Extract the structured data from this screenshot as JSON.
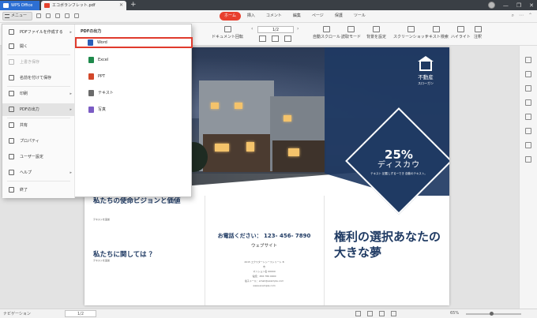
{
  "titlebar": {
    "tabs": [
      {
        "label": "WPS Office"
      },
      {
        "label": "エコボランフレット.pdf"
      }
    ],
    "add_tab": "+",
    "controls": {
      "minimize": "—",
      "restore": "❐",
      "close": "✕"
    }
  },
  "menubar": {
    "menu_label": "メニュー",
    "ribbon_tabs": [
      "ホーム",
      "挿入",
      "コメント",
      "編集",
      "ページ",
      "保護",
      "ツール"
    ],
    "active_tab": "ホーム"
  },
  "toolbar": {
    "doc_rotate": "ドキュメント回転",
    "page_input": "1/2",
    "items": [
      "自動スクロール",
      "読取モード",
      "背景を設定",
      "スクリーンショット",
      "テキスト検索",
      "ハイライト",
      "注釈"
    ]
  },
  "dropdown": {
    "left_items": [
      {
        "label": "PDFファイルを作成する",
        "disabled": false,
        "has_arrow": true
      },
      {
        "label": "開く",
        "disabled": false,
        "has_arrow": false
      },
      {
        "label": "上書き保存",
        "disabled": true,
        "has_arrow": false
      },
      {
        "label": "名前を付けて保存",
        "disabled": false,
        "has_arrow": false
      },
      {
        "label": "印刷",
        "disabled": false,
        "has_arrow": true
      },
      {
        "label": "PDFの出力",
        "disabled": false,
        "has_arrow": true,
        "active": true
      },
      {
        "label": "共有",
        "disabled": false,
        "has_arrow": false
      },
      {
        "label": "プロパティ",
        "disabled": false,
        "has_arrow": false
      },
      {
        "label": "ユーザー設定",
        "disabled": false,
        "has_arrow": false
      },
      {
        "label": "ヘルプ",
        "disabled": false,
        "has_arrow": true
      },
      {
        "label": "終了",
        "disabled": false,
        "has_arrow": false
      }
    ],
    "submenu_title": "PDFの出力",
    "submenu_items": [
      {
        "label": "Word",
        "color": "#2b5eb8",
        "highlighted": true
      },
      {
        "label": "Excel",
        "color": "#1f8a4c"
      },
      {
        "label": "PPT",
        "color": "#d2472a"
      },
      {
        "label": "テキスト",
        "color": "#6b6b6b"
      },
      {
        "label": "写真",
        "color": "#7b5cc4"
      }
    ]
  },
  "document": {
    "logo_title": "不動産",
    "logo_slogan": "スローガン",
    "discount_pct": "25%",
    "discount_label": "ディスカウ",
    "discount_small": "テキスト 記載しずるーでき 自動のテキスト。",
    "vision_title": "私たちの使命ビジョンと価値",
    "vision_sub": "テキストを追加",
    "about_title": "私たちに関しては ？",
    "about_sub": "テキストを追加",
    "phone": "お電話ください： 123- 456- 7890",
    "website": "ウェブサイト",
    "address_1": "2015 エクスタートシーストリート B",
    "address_2": "市",
    "address_3": "マンション名 00000",
    "address_4": "電話：456 789 0000",
    "address_5": "電子メール：email@example.com",
    "address_6": "www.example.com",
    "right_headline": "権利の選択あなたの大きな夢",
    "accent": "#1f3a63"
  },
  "statusbar": {
    "nav_label": "ナビゲーション",
    "page": "1/2",
    "zoom": "65%"
  }
}
